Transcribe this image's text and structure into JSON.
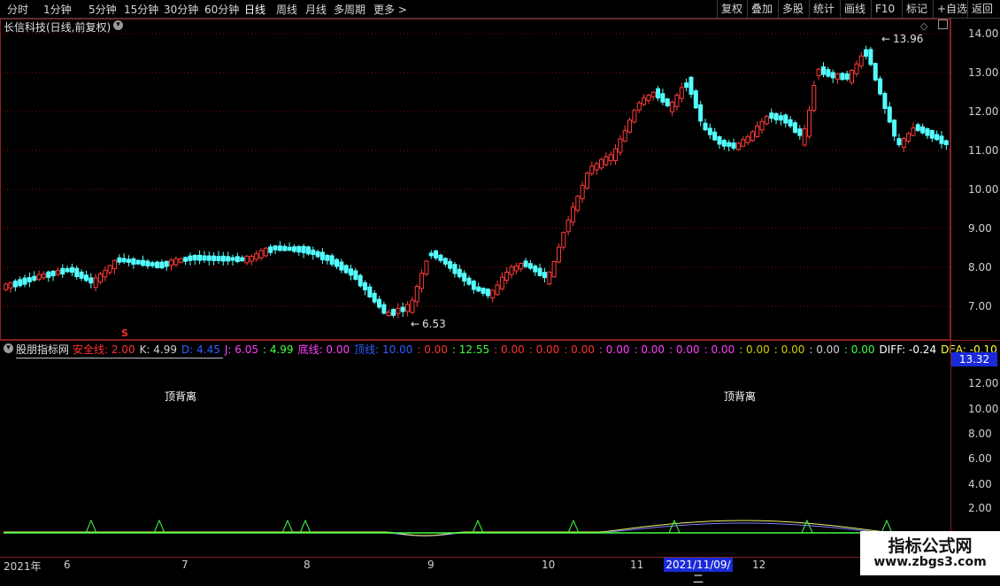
{
  "toolbar": {
    "periods": [
      "分时",
      "1分钟",
      "5分钟",
      "15分钟",
      "30分钟",
      "60分钟",
      "日线",
      "周线",
      "月线",
      "多周期",
      "更多 >"
    ],
    "active_period": "日线",
    "right_buttons": [
      "复权",
      "叠加",
      "多股",
      "统计",
      "画线",
      "F10",
      "标记",
      "+自选",
      "返回"
    ]
  },
  "main_chart": {
    "title": "长信科技(日线,前复权)",
    "price_axis": [
      "14.00",
      "13.00",
      "12.00",
      "11.00",
      "10.00",
      "9.00",
      "8.00",
      "7.00"
    ],
    "high_label": "13.96",
    "low_label": "6.53",
    "marker_s": "S"
  },
  "indicator": {
    "name": "股朋指标网",
    "segments": [
      {
        "text": "安全线: 2.00",
        "color": "#ff3030"
      },
      {
        "text": "K: 4.99",
        "color": "#d0d0d0"
      },
      {
        "text": "D: 4.45",
        "color": "#2f5fff"
      },
      {
        "text": "J: 6.05",
        "color": "#ff40ff"
      },
      {
        "text": ": 4.99",
        "color": "#40ff40"
      },
      {
        "text": "底线: 0.00",
        "color": "#ff40ff"
      },
      {
        "text": "顶线: 10.00",
        "color": "#2f5fff"
      },
      {
        "text": ": 0.00",
        "color": "#ff3030"
      },
      {
        "text": ": 12.55",
        "color": "#40ff40"
      },
      {
        "text": ": 0.00",
        "color": "#ff3030"
      },
      {
        "text": ": 0.00",
        "color": "#ff3030"
      },
      {
        "text": ": 0.00",
        "color": "#ff3030"
      },
      {
        "text": ": 0.00",
        "color": "#ff40ff"
      },
      {
        "text": ": 0.00",
        "color": "#ff40ff"
      },
      {
        "text": ": 0.00",
        "color": "#ff40ff"
      },
      {
        "text": ": 0.00",
        "color": "#ff40ff"
      },
      {
        "text": ": 0.00",
        "color": "#d0d000"
      },
      {
        "text": ": 0.00",
        "color": "#d0d000"
      },
      {
        "text": ": 0.00",
        "color": "#d0d0d0"
      },
      {
        "text": ": 0.00",
        "color": "#40ff40"
      },
      {
        "text": "DIFF: -0.24",
        "color": "#ffffff"
      },
      {
        "text": "DEA: -0.10",
        "color": "#ffff40"
      }
    ],
    "value_box": "13.32",
    "axis": [
      "12.00",
      "10.00",
      "8.00",
      "6.00",
      "4.00",
      "2.00"
    ],
    "label_left": "顶背离",
    "label_right": "顶背离"
  },
  "time_axis": {
    "labels": [
      "2021年",
      "6",
      "7",
      "8",
      "9",
      "10",
      "11",
      "12"
    ],
    "cursor_date": "2021/11/09/二"
  },
  "watermark": {
    "line1": "指标公式网",
    "line2": "www.zbgs3.com"
  },
  "colors": {
    "up": "#ff3a3a",
    "down": "#54ffff",
    "grid": "#7a1010"
  }
}
